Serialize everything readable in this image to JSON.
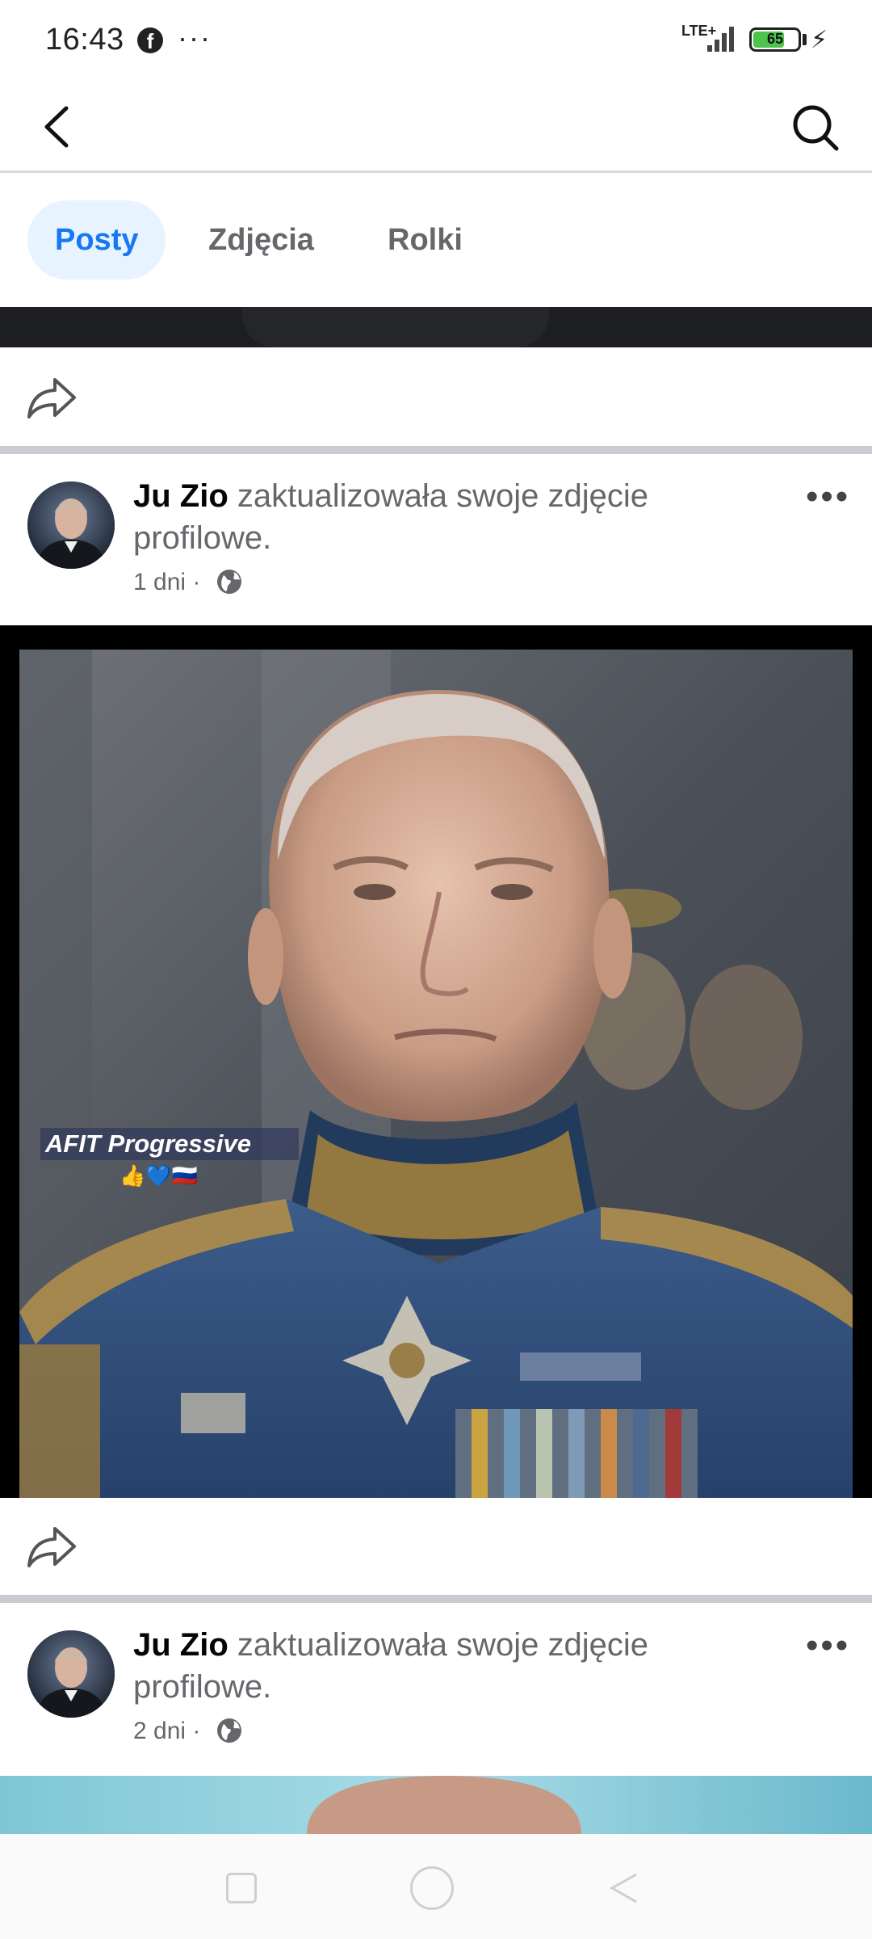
{
  "status_bar": {
    "time": "16:43",
    "app_icon": "facebook-icon",
    "more": "···",
    "network": "LTE+",
    "battery": "65",
    "battery_level": 0.65
  },
  "nav": {
    "back_icon": "chevron-left-icon",
    "search_icon": "search-icon"
  },
  "tabs": [
    {
      "label": "Posty",
      "active": true
    },
    {
      "label": "Zdjęcia",
      "active": false
    },
    {
      "label": "Rolki",
      "active": false
    }
  ],
  "posts": [
    {
      "author": "Ju Zio",
      "action": " zaktualizowała swoje zdjęcie profilowe.",
      "time": "1 dni",
      "separator": "·",
      "audience_icon": "globe-icon",
      "more": "•••",
      "watermark": "AFIT Progressive",
      "watermark_emoji": "👍💙🇷🇺"
    },
    {
      "author": "Ju Zio",
      "action": " zaktualizowała swoje zdjęcie profilowe.",
      "time": "2 dni",
      "separator": "·",
      "audience_icon": "globe-icon",
      "more": "•••"
    }
  ],
  "colors": {
    "accent": "#1877f2",
    "tab_active_bg": "#e7f3ff",
    "secondary_text": "#65676b",
    "divider": "#c9ccd1"
  }
}
